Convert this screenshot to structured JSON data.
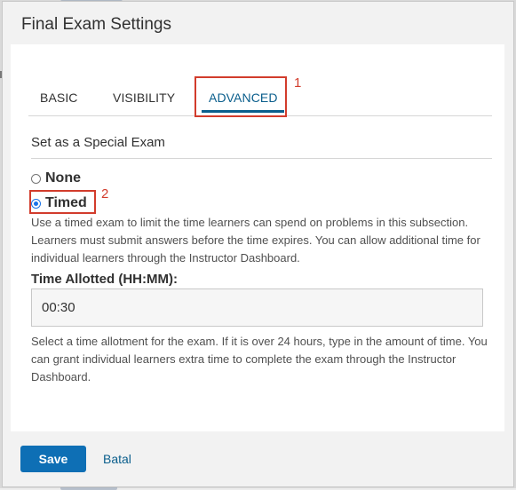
{
  "dialog": {
    "title": "Final Exam Settings"
  },
  "tabs": [
    {
      "label": "BASIC",
      "active": false
    },
    {
      "label": "VISIBILITY",
      "active": false
    },
    {
      "label": "ADVANCED",
      "active": true
    }
  ],
  "annotations": {
    "tab_marker": "1",
    "radio_marker": "2",
    "color": "#d23c2c"
  },
  "special_exam": {
    "section_title": "Set as a Special Exam",
    "options": [
      {
        "label": "None",
        "selected": false
      },
      {
        "label": "Timed",
        "selected": true
      }
    ],
    "timed_description": "Use a timed exam to limit the time learners can spend on problems in this subsection. Learners must submit answers before the time expires. You can allow additional time for individual learners through the Instructor Dashboard.",
    "time_allotted_label": "Time Allotted (HH:MM):",
    "time_allotted_value": "00:30",
    "time_allotted_help": "Select a time allotment for the exam. If it is over 24 hours, type in the amount of time. You can grant individual learners extra time to complete the exam through the Instructor Dashboard."
  },
  "footer": {
    "save_label": "Save",
    "cancel_label": "Batal"
  },
  "colors": {
    "accent": "#0a5e8c",
    "primary_button": "#0e6fb5"
  }
}
